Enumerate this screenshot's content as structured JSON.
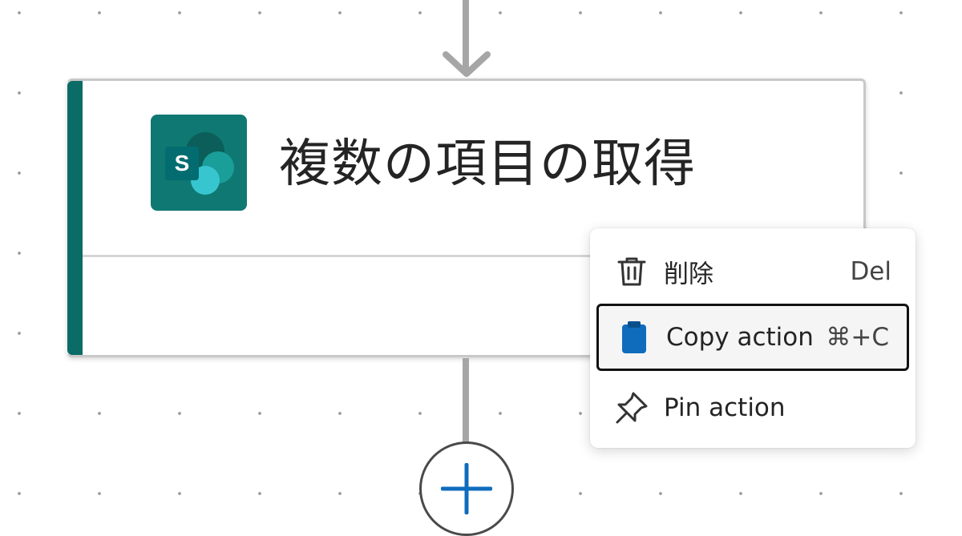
{
  "card": {
    "title": "複数の項目の取得",
    "connector_icon": "sharepoint-icon",
    "connector_letter": "S",
    "accent_color": "#0b6b66"
  },
  "context_menu": {
    "items": [
      {
        "label": "削除",
        "shortcut": "Del",
        "icon": "trash-icon"
      },
      {
        "label": "Copy action",
        "shortcut": "⌘+C",
        "icon": "clipboard-icon",
        "focused": true
      },
      {
        "label": "Pin action",
        "shortcut": "",
        "icon": "pin-icon"
      }
    ]
  },
  "flow": {
    "add_icon": "plus-icon",
    "arrow_icon": "arrow-down-icon",
    "add_color": "#0f6cbd"
  }
}
